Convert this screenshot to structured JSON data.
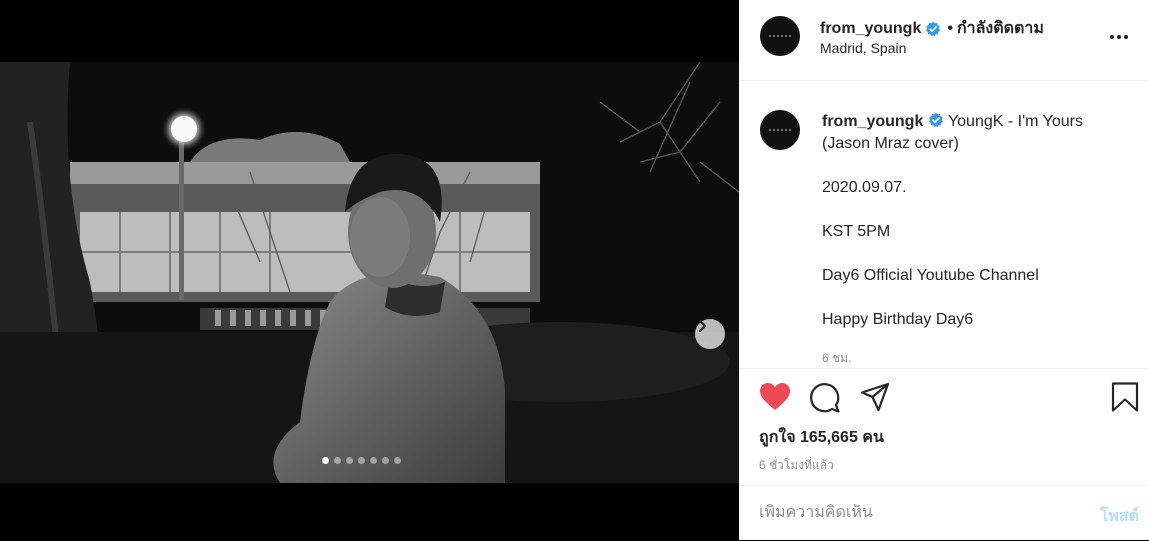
{
  "post": {
    "username": "from_youngk",
    "follow_separator": "•",
    "follow_label": "กำลังติดตาม",
    "location": "Madrid, Spain",
    "caption_title": "YoungK - I'm Yours (Jason Mraz cover)",
    "caption_lines": [
      "2020.09.07.",
      "KST 5PM",
      "Day6 Official Youtube Channel",
      "Happy Birthday Day6"
    ],
    "caption_time": "6 ชม.",
    "likes_text": "ถูกใจ 165,665 คน",
    "post_time": "6 ชั่วโมงที่แล้ว",
    "comment_placeholder": "เพิ่มความคิดเห็น",
    "post_button": "โพสต์"
  },
  "carousel": {
    "total": 7,
    "active_index": 0
  },
  "icons": {
    "verified": "verified-badge-icon",
    "more": "more-options-icon",
    "like": "heart-icon",
    "comment": "comment-icon",
    "share": "share-icon",
    "save": "bookmark-icon",
    "next": "chevron-right-icon"
  },
  "colors": {
    "like_active": "#ed4956",
    "verified": "#3897f0",
    "post_button_disabled": "#b2dffc"
  }
}
